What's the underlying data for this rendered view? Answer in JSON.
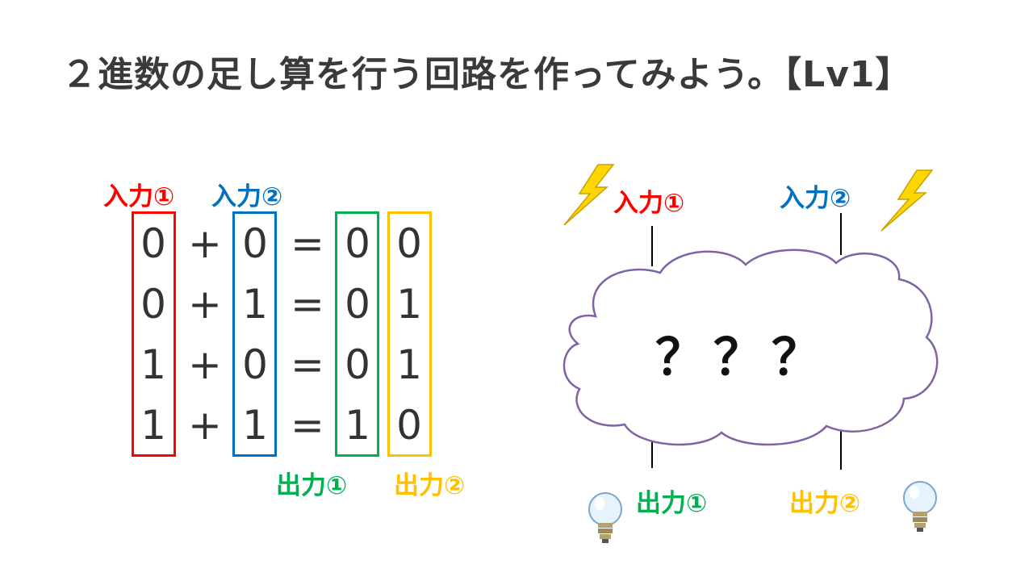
{
  "title": "２進数の足し算を行う回路を作ってみよう。【Lv1】",
  "table": {
    "input1_label": "入力①",
    "input2_label": "入力②",
    "output1_label": "出力①",
    "output2_label": "出力②",
    "plus": "+",
    "equals": "=",
    "rows": [
      {
        "a": "0",
        "b": "0",
        "c": "0",
        "d": "0"
      },
      {
        "a": "0",
        "b": "1",
        "c": "0",
        "d": "1"
      },
      {
        "a": "1",
        "b": "0",
        "c": "0",
        "d": "1"
      },
      {
        "a": "1",
        "b": "1",
        "c": "1",
        "d": "0"
      }
    ]
  },
  "circuit": {
    "input1_label": "入力①",
    "input2_label": "入力②",
    "output1_label": "出力①",
    "output2_label": "出力②",
    "unknown": "？？？"
  },
  "colors": {
    "input1": "#ff0000",
    "input2": "#0070c0",
    "output1": "#00b050",
    "output2": "#ffc000",
    "cloud": "#8064a2"
  },
  "icons": [
    "lightning-icon",
    "light-bulb-icon"
  ]
}
